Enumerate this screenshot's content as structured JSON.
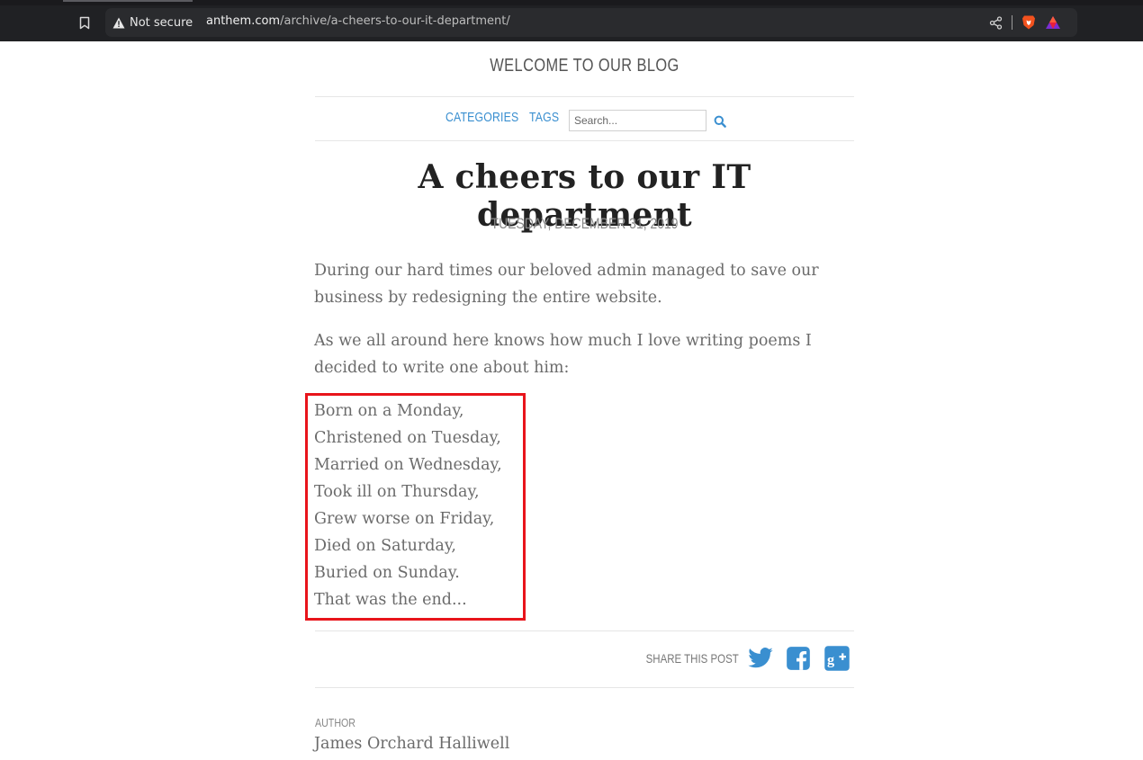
{
  "browser": {
    "security_label": "Not secure",
    "url_host": "anthem.com",
    "url_path": "/archive/a-cheers-to-our-it-department/"
  },
  "blog": {
    "title": "WELCOME TO OUR BLOG"
  },
  "nav": {
    "categories": "CATEGORIES",
    "tags": "TAGS",
    "search_placeholder": "Search..."
  },
  "post": {
    "title": "A cheers to our IT department",
    "date": "TUESDAY, DECEMBER 31, 2019",
    "paragraphs": [
      "During our hard times our beloved admin managed to save our business by redesigning the entire website.",
      "As we all around here knows how much I love writing poems I decided to write one about him:"
    ],
    "poem": [
      "Born on a Monday,",
      "Christened on Tuesday,",
      "Married on Wednesday,",
      "Took ill on Thursday,",
      "Grew worse on Friday,",
      "Died on Saturday,",
      "Buried on Sunday.",
      "That was the end..."
    ]
  },
  "share": {
    "label": "SHARE THIS POST",
    "icons": [
      "twitter-icon",
      "facebook-icon",
      "google-plus-icon"
    ]
  },
  "author": {
    "label": "AUTHOR",
    "name": "James Orchard Halliwell"
  },
  "colors": {
    "link": "#3a8fd0",
    "highlight": "#e8141b",
    "text": "#6b6b6b"
  }
}
